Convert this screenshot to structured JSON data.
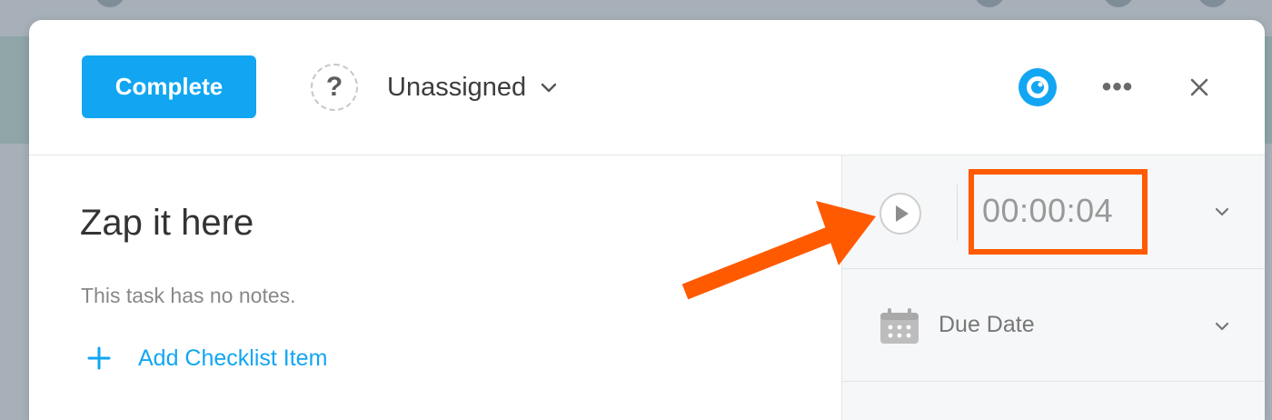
{
  "header": {
    "complete_label": "Complete",
    "assignee_avatar": "?",
    "assignee_label": "Unassigned",
    "more_label": "•••"
  },
  "task": {
    "title": "Zap it here",
    "notes": "This task has no notes.",
    "add_checklist_label": "Add Checklist Item"
  },
  "sidebar": {
    "timer_value": "00:00:04",
    "due_date_label": "Due Date"
  },
  "icons": {
    "assignee": "question-avatar-icon",
    "assignee_dropdown": "chevron-down-icon",
    "watch": "eye-icon",
    "more": "more-dots-icon",
    "close": "close-icon",
    "add": "plus-icon",
    "timer_start": "play-icon",
    "timer_dropdown": "chevron-down-icon",
    "due_date": "calendar-icon",
    "due_date_dropdown": "chevron-down-icon"
  },
  "colors": {
    "accent": "#12a6f2",
    "annotation": "#ff5a00"
  }
}
